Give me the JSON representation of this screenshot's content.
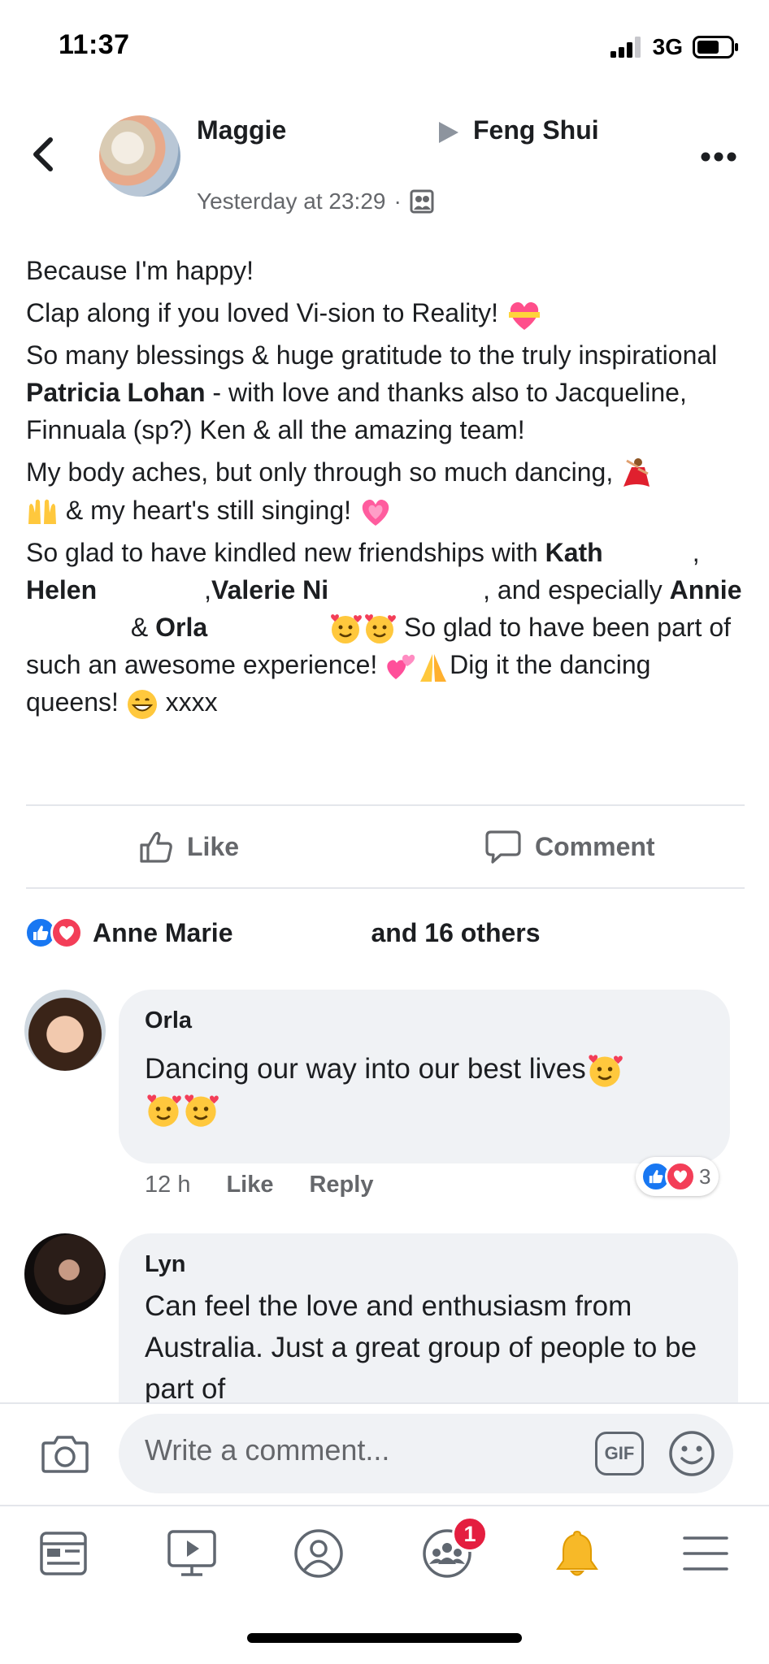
{
  "status_bar": {
    "time": "11:37",
    "network": "3G"
  },
  "post": {
    "author": "Maggie",
    "group": "Feng Shui",
    "timestamp": "Yesterday at 23:29",
    "separator": "·",
    "body": {
      "l1": "Because I'm happy!",
      "l2": "Clap along if you loved Vi-sion to Reality!",
      "l3a": "So many blessings & huge gratitude to the truly inspirational ",
      "l3_name": "Patricia Lohan",
      "l3b": " - with love and thanks also to Jacqueline, Finnuala (sp?) Ken & all the amazing team!",
      "l4a": "My body aches, but only through so much dancing,",
      "l4b": " &  my heart's still singing!",
      "l5a": "So glad to have kindled new friendships with ",
      "n_kath": "Kath",
      "sep1": ", ",
      "n_helen": "Helen",
      "sep2": ",",
      "n_valerie": "Valerie Ni",
      "l5b": ", and especially ",
      "n_annie": "Annie",
      "l5c": " & ",
      "n_orla": "Orla",
      "l5d": " So glad to have been part of such an awesome experience!",
      "l5e": "Dig it the dancing queens!",
      "l5f": " xxxx"
    }
  },
  "actions": {
    "like": "Like",
    "comment": "Comment"
  },
  "reactions": {
    "first_name": "Anne Marie",
    "others": "and 16 others"
  },
  "comments": [
    {
      "name": "Orla",
      "text": "Dancing our way into our best lives",
      "time": "12 h",
      "like": "Like",
      "reply": "Reply",
      "reaction_count": "3"
    },
    {
      "name": "Lyn",
      "text": "Can feel the love and enthusiasm from Australia. Just a great group of people to be part of"
    }
  ],
  "composer": {
    "placeholder": "Write a comment...",
    "gif": "GIF"
  },
  "tabbar": {
    "groups_badge": "1"
  },
  "colors": {
    "accent": "#1877f2",
    "love": "#f33e58",
    "badge": "#e41e3f",
    "bell": "#f7b928"
  }
}
